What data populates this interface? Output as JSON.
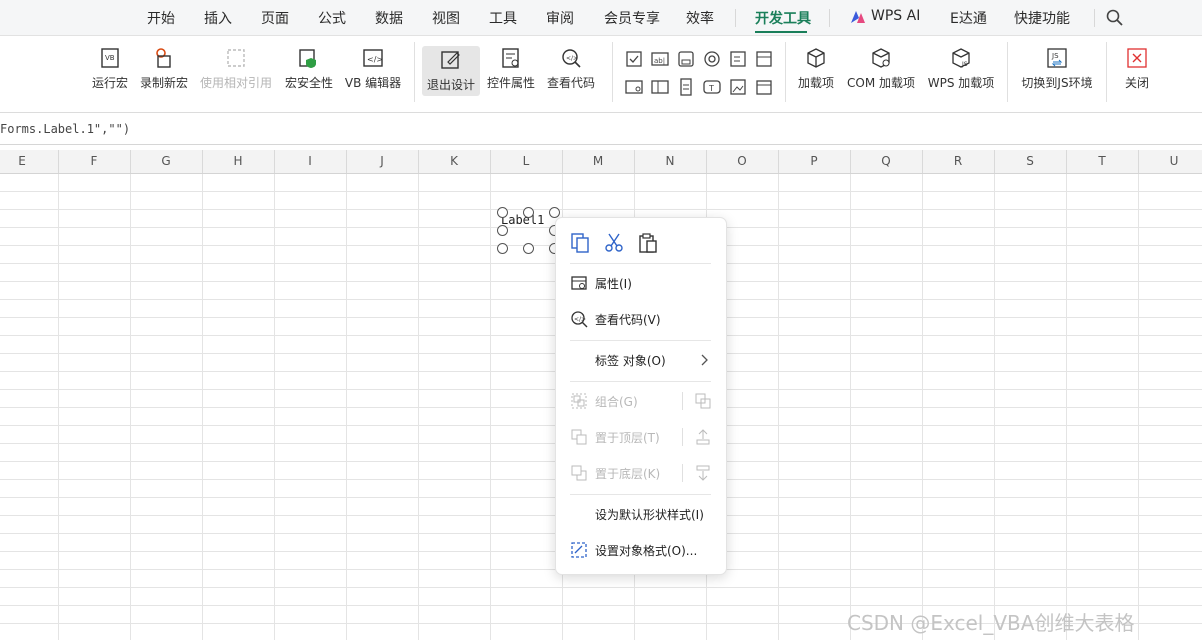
{
  "tabs": [
    {
      "label": "开始"
    },
    {
      "label": "插入"
    },
    {
      "label": "页面"
    },
    {
      "label": "公式"
    },
    {
      "label": "数据"
    },
    {
      "label": "视图"
    },
    {
      "label": "工具"
    },
    {
      "label": "审阅"
    },
    {
      "label": "会员专享"
    },
    {
      "label": "效率"
    },
    {
      "label": "开发工具"
    },
    {
      "label": "WPS AI"
    },
    {
      "label": "E达通"
    },
    {
      "label": "快捷功能"
    }
  ],
  "active_tab": "开发工具",
  "ribbon": {
    "run_macro": "运行宏",
    "record_macro": "录制新宏",
    "relative_ref": "使用相对引用",
    "macro_security": "宏安全性",
    "vb_editor": "VB 编辑器",
    "exit_design": "退出设计",
    "control_props": "控件属性",
    "view_code": "查看代码",
    "addins": "加载项",
    "com_addins": "COM 加载项",
    "wps_addins": "WPS 加载项",
    "switch_js": "切换到JS环境",
    "close": "关闭"
  },
  "formula_text": "Forms.Label.1\",\"\")",
  "columns": [
    "E",
    "F",
    "G",
    "H",
    "I",
    "J",
    "K",
    "L",
    "M",
    "N",
    "O",
    "P",
    "Q",
    "R",
    "S",
    "T",
    "U"
  ],
  "label_control_text": "Label1",
  "context_menu": {
    "properties": "属性(I)",
    "view_code": "查看代码(V)",
    "label_object": "标签 对象(O)",
    "group": "组合(G)",
    "bring_front": "置于顶层(T)",
    "send_back": "置于底层(K)",
    "default_style": "设为默认形状样式(I)",
    "format_object": "设置对象格式(O)..."
  },
  "watermark": "CSDN @Excel_VBA创维大表格",
  "colors": {
    "accent": "#1a7f5a",
    "disabled": "#b8b8b8"
  }
}
